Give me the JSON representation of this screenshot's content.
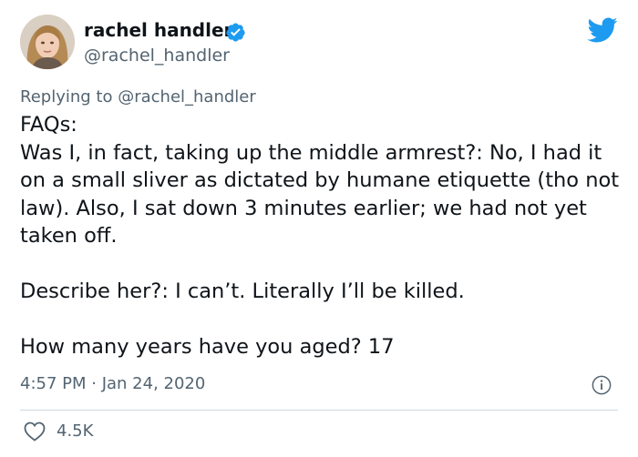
{
  "author": {
    "display_name": "rachel handler",
    "handle": "@rachel_handler",
    "verified": true
  },
  "reply": {
    "prefix": "Replying to ",
    "mention": "@rachel_handler"
  },
  "tweet": {
    "lines": [
      "FAQs:",
      "Was I, in fact, taking up the middle armrest?: No, I had it on a small sliver as dictated by humane etiquette (tho not law). Also, I sat down 3 minutes earlier; we had not yet taken off.",
      "Describe her?: I can’t. Literally I’ll be killed.",
      "How many years have you aged? 17"
    ],
    "timestamp": "4:57 PM · Jan 24, 2020"
  },
  "actions": {
    "like_count": "4.5K"
  },
  "icons": {
    "brand": "twitter-bird-icon",
    "verified": "verified-badge-icon",
    "info": "info-icon",
    "like": "heart-icon"
  },
  "colors": {
    "brand_blue": "#1d9bf0",
    "secondary_text": "#536471",
    "primary_text": "#0f1419",
    "divider": "#cfd9de"
  }
}
